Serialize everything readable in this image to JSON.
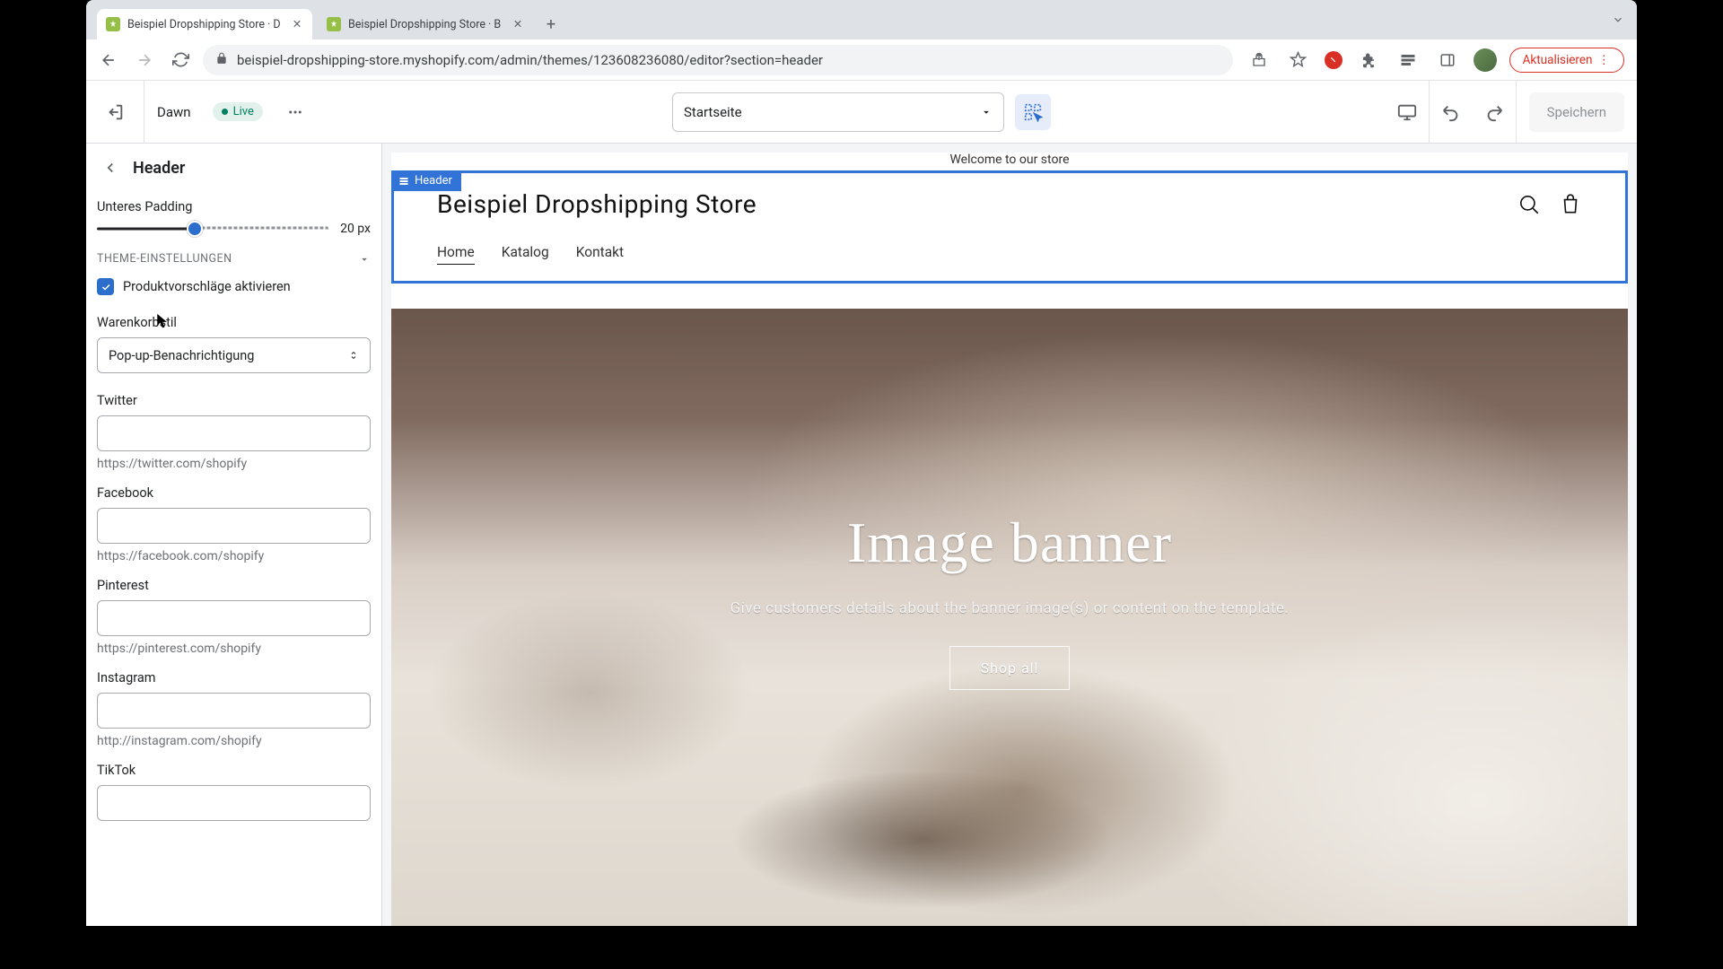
{
  "browser": {
    "tabs": [
      {
        "title": "Beispiel Dropshipping Store · D"
      },
      {
        "title": "Beispiel Dropshipping Store · B"
      }
    ],
    "url": "beispiel-dropshipping-store.myshopify.com/admin/themes/123608236080/editor?section=header",
    "update_label": "Aktualisieren"
  },
  "toolbar": {
    "theme_name": "Dawn",
    "live_label": "Live",
    "page_select": "Startseite",
    "save_label": "Speichern"
  },
  "sidebar": {
    "title": "Header",
    "padding": {
      "label": "Unteres Padding",
      "value_label": "20 px",
      "percent": 42
    },
    "section_caption": "THEME-EINSTELLUNGEN",
    "suggestions_label": "Produktvorschläge aktivieren",
    "cart": {
      "label": "Warenkorbstil",
      "value": "Pop-up-Benachrichtigung"
    },
    "socials": [
      {
        "label": "Twitter",
        "help": "https://twitter.com/shopify"
      },
      {
        "label": "Facebook",
        "help": "https://facebook.com/shopify"
      },
      {
        "label": "Pinterest",
        "help": "https://pinterest.com/shopify"
      },
      {
        "label": "Instagram",
        "help": "http://instagram.com/shopify"
      },
      {
        "label": "TikTok",
        "help": ""
      }
    ]
  },
  "preview": {
    "announcement": "Welcome to our store",
    "header_tag": "Header",
    "store_title": "Beispiel Dropshipping Store",
    "nav": {
      "home": "Home",
      "catalog": "Katalog",
      "contact": "Kontakt"
    },
    "banner": {
      "title": "Image banner",
      "subtitle": "Give customers details about the banner image(s) or content on the template.",
      "button": "Shop all"
    }
  }
}
